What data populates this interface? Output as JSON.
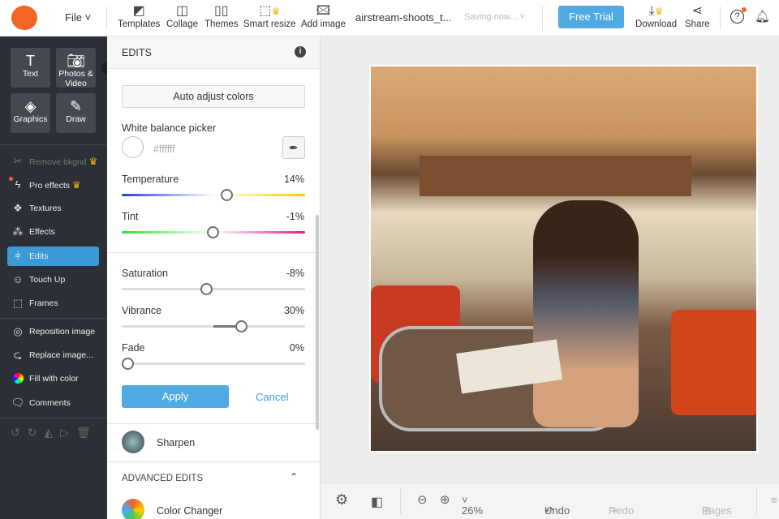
{
  "topbar": {
    "file": "File",
    "tools": [
      {
        "label": "Templates",
        "icon": "templates-icon"
      },
      {
        "label": "Collage",
        "icon": "collage-icon"
      },
      {
        "label": "Themes",
        "icon": "themes-icon"
      },
      {
        "label": "Smart resize",
        "icon": "smart-resize-icon"
      },
      {
        "label": "Add image",
        "icon": "add-image-icon"
      }
    ],
    "filename": "airstream-shoots_t...",
    "status": "Saving now...",
    "free_trial": "Free Trial",
    "download": "Download",
    "share": "Share"
  },
  "sidebar": {
    "big": [
      {
        "label": "Text"
      },
      {
        "label": "Photos & Video"
      },
      {
        "label": "Graphics"
      },
      {
        "label": "Draw"
      }
    ],
    "items": [
      {
        "label": "Remove bkgnd"
      },
      {
        "label": "Pro effects"
      },
      {
        "label": "Textures"
      },
      {
        "label": "Effects"
      },
      {
        "label": "Edits"
      },
      {
        "label": "Touch Up"
      },
      {
        "label": "Frames"
      },
      {
        "label": "Reposition image"
      },
      {
        "label": "Replace image..."
      },
      {
        "label": "Fill with color"
      },
      {
        "label": "Comments"
      }
    ]
  },
  "panel": {
    "title": "EDITS",
    "auto_adjust": "Auto adjust colors",
    "wb_label": "White balance picker",
    "wb_value": "#ffffff",
    "sliders": [
      {
        "label": "Temperature",
        "value": "14%",
        "pct": 14
      },
      {
        "label": "Tint",
        "value": "-1%",
        "pct": -1
      },
      {
        "label": "Saturation",
        "value": "-8%",
        "pct": -8
      },
      {
        "label": "Vibrance",
        "value": "30%",
        "pct": 30
      },
      {
        "label": "Fade",
        "value": "0%",
        "pct": 0
      }
    ],
    "apply": "Apply",
    "cancel": "Cancel",
    "sharpen": "Sharpen",
    "advanced": "ADVANCED EDITS",
    "color_changer": "Color Changer"
  },
  "bottom": {
    "zoom": "26%",
    "undo": "Undo",
    "redo": "Redo",
    "pages": "Pages"
  },
  "colors": {
    "accent": "#3d9ad9",
    "sidebar": "#2b2f36",
    "logo": "#f26522"
  }
}
